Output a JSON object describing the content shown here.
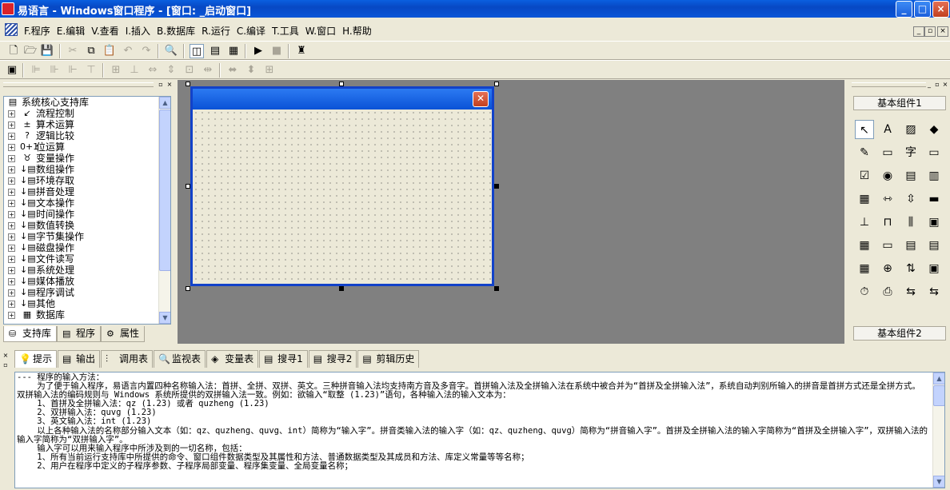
{
  "window": {
    "title": "易语言 - Windows窗口程序 - [窗口: _启动窗口]",
    "buttons": {
      "minimize": "_",
      "maximize": "□",
      "close": "×"
    }
  },
  "menu": {
    "items": [
      "F.程序",
      "E.编辑",
      "V.查看",
      "I.插入",
      "B.数据库",
      "R.运行",
      "C.编译",
      "T.工具",
      "W.窗口",
      "H.帮助"
    ],
    "mdi_buttons": [
      "_",
      "▫",
      "×"
    ]
  },
  "toolbar1": {
    "buttons": [
      {
        "icon": "new-file-icon",
        "glyph": "🗋"
      },
      {
        "icon": "open-folder-icon",
        "glyph": "🗁"
      },
      {
        "icon": "save-icon",
        "glyph": "💾"
      },
      {
        "icon": "cut-icon",
        "glyph": "✂"
      },
      {
        "icon": "copy-icon",
        "glyph": "⧉"
      },
      {
        "icon": "paste-icon",
        "glyph": "📋"
      },
      {
        "icon": "undo-icon",
        "glyph": "↶"
      },
      {
        "icon": "redo-icon",
        "glyph": "↷"
      },
      {
        "icon": "find-icon",
        "glyph": "🔍"
      },
      {
        "icon": "layout-1-icon",
        "glyph": "◫"
      },
      {
        "icon": "layout-2-icon",
        "glyph": "▤"
      },
      {
        "icon": "layout-3-icon",
        "glyph": "▦"
      },
      {
        "icon": "run-icon",
        "glyph": "▶"
      },
      {
        "icon": "stop-icon",
        "glyph": "■"
      },
      {
        "icon": "inspect-icon",
        "glyph": "♜"
      }
    ]
  },
  "toolbar2": {
    "buttons": [
      {
        "icon": "form-icon",
        "glyph": "▣"
      },
      {
        "icon": "align-left-icon",
        "glyph": "⊫"
      },
      {
        "icon": "align-center-icon",
        "glyph": "⊪"
      },
      {
        "icon": "align-right-icon",
        "glyph": "⊩"
      },
      {
        "icon": "align-top-icon",
        "glyph": "⊤"
      },
      {
        "icon": "align-middle-icon",
        "glyph": "⊞"
      },
      {
        "icon": "align-bottom-icon",
        "glyph": "⊥"
      },
      {
        "icon": "same-width-icon",
        "glyph": "⇔"
      },
      {
        "icon": "same-height-icon",
        "glyph": "⇕"
      },
      {
        "icon": "same-size-icon",
        "glyph": "⊡"
      },
      {
        "icon": "hspace-icon",
        "glyph": "⇹"
      },
      {
        "icon": "vspace-icon",
        "glyph": "⇳"
      },
      {
        "icon": "center-h-icon",
        "glyph": "⬌"
      },
      {
        "icon": "center-v-icon",
        "glyph": "⬍"
      },
      {
        "icon": "grid-icon",
        "glyph": "⊞"
      }
    ]
  },
  "tree": {
    "root": "系统核心支持库",
    "items": [
      {
        "label": "流程控制",
        "icon": "flow-icon",
        "glyph": "↙"
      },
      {
        "label": "算术运算",
        "icon": "arith-icon",
        "glyph": "±"
      },
      {
        "label": "逻辑比较",
        "icon": "logic-icon",
        "glyph": "?"
      },
      {
        "label": "位运算",
        "icon": "bit-icon",
        "glyph": "0+1"
      },
      {
        "label": "变量操作",
        "icon": "var-icon",
        "glyph": "♉"
      },
      {
        "label": "数组操作",
        "icon": "cmd-icon",
        "glyph": "↓▤"
      },
      {
        "label": "环境存取",
        "icon": "cmd-icon",
        "glyph": "↓▤"
      },
      {
        "label": "拼音处理",
        "icon": "cmd-icon",
        "glyph": "↓▤"
      },
      {
        "label": "文本操作",
        "icon": "cmd-icon",
        "glyph": "↓▤"
      },
      {
        "label": "时间操作",
        "icon": "cmd-icon",
        "glyph": "↓▤"
      },
      {
        "label": "数值转换",
        "icon": "cmd-icon",
        "glyph": "↓▤"
      },
      {
        "label": "字节集操作",
        "icon": "cmd-icon",
        "glyph": "↓▤"
      },
      {
        "label": "磁盘操作",
        "icon": "cmd-icon",
        "glyph": "↓▤"
      },
      {
        "label": "文件读写",
        "icon": "cmd-icon",
        "glyph": "↓▤"
      },
      {
        "label": "系统处理",
        "icon": "cmd-icon",
        "glyph": "↓▤"
      },
      {
        "label": "媒体播放",
        "icon": "cmd-icon",
        "glyph": "↓▤"
      },
      {
        "label": "程序调试",
        "icon": "cmd-icon",
        "glyph": "↓▤"
      },
      {
        "label": "其他",
        "icon": "cmd-icon",
        "glyph": "↓▤"
      },
      {
        "label": "数据库",
        "icon": "db-icon",
        "glyph": "▦"
      }
    ]
  },
  "left_tabs": [
    {
      "label": "支持库",
      "glyph": "⛁"
    },
    {
      "label": "程序",
      "glyph": "▤"
    },
    {
      "label": "属性",
      "glyph": "⚙"
    }
  ],
  "palette": {
    "group1": "基本组件1",
    "group2": "基本组件2",
    "items": [
      {
        "name": "pointer",
        "glyph": "↖"
      },
      {
        "name": "label",
        "glyph": "A"
      },
      {
        "name": "picture",
        "glyph": "▨"
      },
      {
        "name": "shape",
        "glyph": "◆"
      },
      {
        "name": "drawbox",
        "glyph": "✎"
      },
      {
        "name": "groupbox",
        "glyph": "▭"
      },
      {
        "name": "textbox",
        "glyph": "字"
      },
      {
        "name": "button",
        "glyph": "▭"
      },
      {
        "name": "checkbox",
        "glyph": "☑"
      },
      {
        "name": "radio",
        "glyph": "◉"
      },
      {
        "name": "combobox",
        "glyph": "▤"
      },
      {
        "name": "listbox",
        "glyph": "▥"
      },
      {
        "name": "multilist",
        "glyph": "▦"
      },
      {
        "name": "hscroll",
        "glyph": "⇿"
      },
      {
        "name": "vscroll",
        "glyph": "⇳"
      },
      {
        "name": "progress",
        "glyph": "▬"
      },
      {
        "name": "slider",
        "glyph": "⊥"
      },
      {
        "name": "tab",
        "glyph": "⊓"
      },
      {
        "name": "toolbar",
        "glyph": "⫼"
      },
      {
        "name": "frame",
        "glyph": "▣"
      },
      {
        "name": "table",
        "glyph": "▦"
      },
      {
        "name": "edit",
        "glyph": "▭"
      },
      {
        "name": "gif",
        "glyph": "▤"
      },
      {
        "name": "document",
        "glyph": "▤"
      },
      {
        "name": "calendar",
        "glyph": "▦"
      },
      {
        "name": "network",
        "glyph": "⊕"
      },
      {
        "name": "updown",
        "glyph": "⇅"
      },
      {
        "name": "window",
        "glyph": "▣"
      },
      {
        "name": "timer",
        "glyph": "⏱"
      },
      {
        "name": "printer",
        "glyph": "⎙"
      },
      {
        "name": "datasource",
        "glyph": "⇆"
      },
      {
        "name": "dataprovider",
        "glyph": "⇆"
      }
    ]
  },
  "bottom_tabs": [
    {
      "label": "提示",
      "glyph": "💡"
    },
    {
      "label": "输出",
      "glyph": "▤"
    },
    {
      "label": "调用表",
      "glyph": "⫶"
    },
    {
      "label": "监视表",
      "glyph": "🔍"
    },
    {
      "label": "变量表",
      "glyph": "◈"
    },
    {
      "label": "搜寻1",
      "glyph": "▤"
    },
    {
      "label": "搜寻2",
      "glyph": "▤"
    },
    {
      "label": "剪辑历史",
      "glyph": "▤"
    }
  ],
  "output_lines": [
    "--- 程序的输入方法：",
    "    为了便于输入程序，易语言内置四种名称输入法：首拼、全拼、双拼、英文。三种拼音输入法均支持南方音及多音字。首拼输入法及全拼输入法在系统中被合并为“首拼及全拼输入法”，系统自动判别所输入的拼音是首拼方式还是全拼方式。双拼输入法的编码规则与 Windows 系统所提供的双拼输入法一致。例如：欲输入“取整 (1.23)”语句，各种输入法的输入文本为：",
    "    1、首拼及全拼输入法：qz (1.23) 或者 quzheng (1.23)",
    "    2、双拼输入法：quvg (1.23)",
    "    3、英文输入法：int (1.23)",
    "    以上各种输入法的名称部分输入文本（如：qz、quzheng、quvg、int）简称为“输入字”。拼音类输入法的输入字（如：qz、quzheng、quvg）简称为“拼音输入字”。首拼及全拼输入法的输入字简称为“首拼及全拼输入字”，双拼输入法的输入字简称为“双拼输入字”。",
    "    输入字可以用来输入程序中所涉及到的一切名称，包括：",
    "    1、所有当前运行支持库中所提供的命令、窗口组件数据类型及其属性和方法、普通数据类型及其成员和方法、库定义常量等等名称；",
    "    2、用户在程序中定义的子程序参数、子程序局部变量、程序集变量、全局变量名称；"
  ]
}
